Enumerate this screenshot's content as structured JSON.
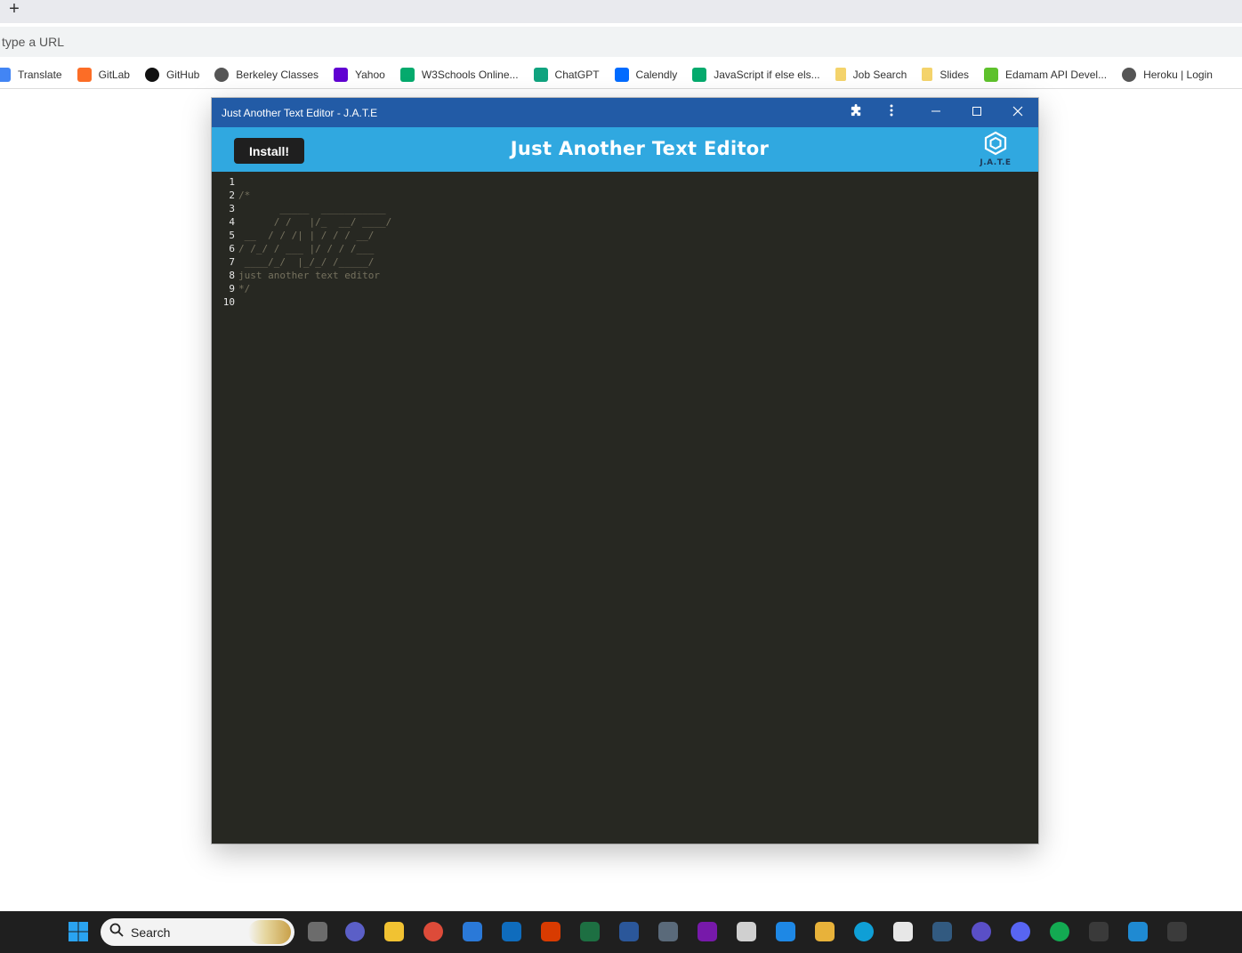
{
  "browser": {
    "new_tab": "+",
    "address_placeholder": "type a URL",
    "bookmarks": [
      {
        "label": "Translate",
        "icon": "translate-icon",
        "color": "#4285f4"
      },
      {
        "label": "GitLab",
        "icon": "gitlab-icon",
        "color": "#fc6d26"
      },
      {
        "label": "GitHub",
        "icon": "github-icon",
        "color": "#111111"
      },
      {
        "label": "Berkeley Classes",
        "icon": "globe-icon",
        "color": "#555555"
      },
      {
        "label": "Yahoo",
        "icon": "yahoo-icon",
        "color": "#6001d2"
      },
      {
        "label": "W3Schools Online...",
        "icon": "w3schools-icon",
        "color": "#04aa6d"
      },
      {
        "label": "ChatGPT",
        "icon": "chatgpt-icon",
        "color": "#10a37f"
      },
      {
        "label": "Calendly",
        "icon": "calendly-icon",
        "color": "#006bff"
      },
      {
        "label": "JavaScript if else els...",
        "icon": "w3schools-icon",
        "color": "#04aa6d"
      },
      {
        "label": "Job Search",
        "icon": "folder-icon",
        "color": "#f4d36b"
      },
      {
        "label": "Slides",
        "icon": "folder-icon",
        "color": "#f4d36b"
      },
      {
        "label": "Edamam API Devel...",
        "icon": "edamam-icon",
        "color": "#5ec12c"
      },
      {
        "label": "Heroku | Login",
        "icon": "globe-icon",
        "color": "#555555"
      }
    ]
  },
  "app_window": {
    "title": "Just Another Text Editor - J.A.T.E",
    "titlebar_color": "#225ba6",
    "header_color": "#30a8e0",
    "install_label": "Install!",
    "heading": "Just Another Text Editor",
    "logo_text": "J.A.T.E"
  },
  "editor": {
    "lines": [
      {
        "n": "1",
        "text": ""
      },
      {
        "n": "2",
        "text": "/*"
      },
      {
        "n": "3",
        "text": "       _____  ___________"
      },
      {
        "n": "4",
        "text": "      / /   |/_  __/ ____/"
      },
      {
        "n": "5",
        "text": " __  / / /| | / / / __/"
      },
      {
        "n": "6",
        "text": "/ /_/ / ___ |/ / / /___"
      },
      {
        "n": "7",
        "text": " ____/_/  |_/_/ /_____/"
      },
      {
        "n": "8",
        "text": "just another text editor"
      },
      {
        "n": "9",
        "text": "*/"
      },
      {
        "n": "10",
        "text": ""
      }
    ]
  },
  "taskbar": {
    "search_label": "Search"
  }
}
